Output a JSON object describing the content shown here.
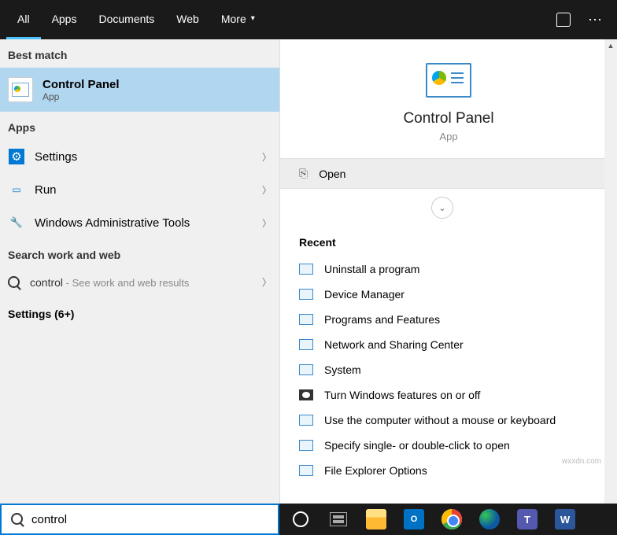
{
  "tabs": {
    "all": "All",
    "apps": "Apps",
    "documents": "Documents",
    "web": "Web",
    "more": "More"
  },
  "sections": {
    "best": "Best match",
    "apps": "Apps",
    "searchWeb": "Search work and web"
  },
  "bestMatch": {
    "title": "Control Panel",
    "sub": "App"
  },
  "appsList": {
    "settings": "Settings",
    "run": "Run",
    "admin": "Windows Administrative Tools"
  },
  "webSearch": {
    "term": "control",
    "hint": " - See work and web results"
  },
  "moreSection": "Settings (6+)",
  "preview": {
    "title": "Control Panel",
    "sub": "App",
    "open": "Open"
  },
  "recent": {
    "label": "Recent",
    "items": [
      "Uninstall a program",
      "Device Manager",
      "Programs and Features",
      "Network and Sharing Center",
      "System",
      "Turn Windows features on or off",
      "Use the computer without a mouse or keyboard",
      "Specify single- or double-click to open",
      "File Explorer Options"
    ]
  },
  "search": {
    "value": "control"
  },
  "watermark": "wxxdn.com"
}
